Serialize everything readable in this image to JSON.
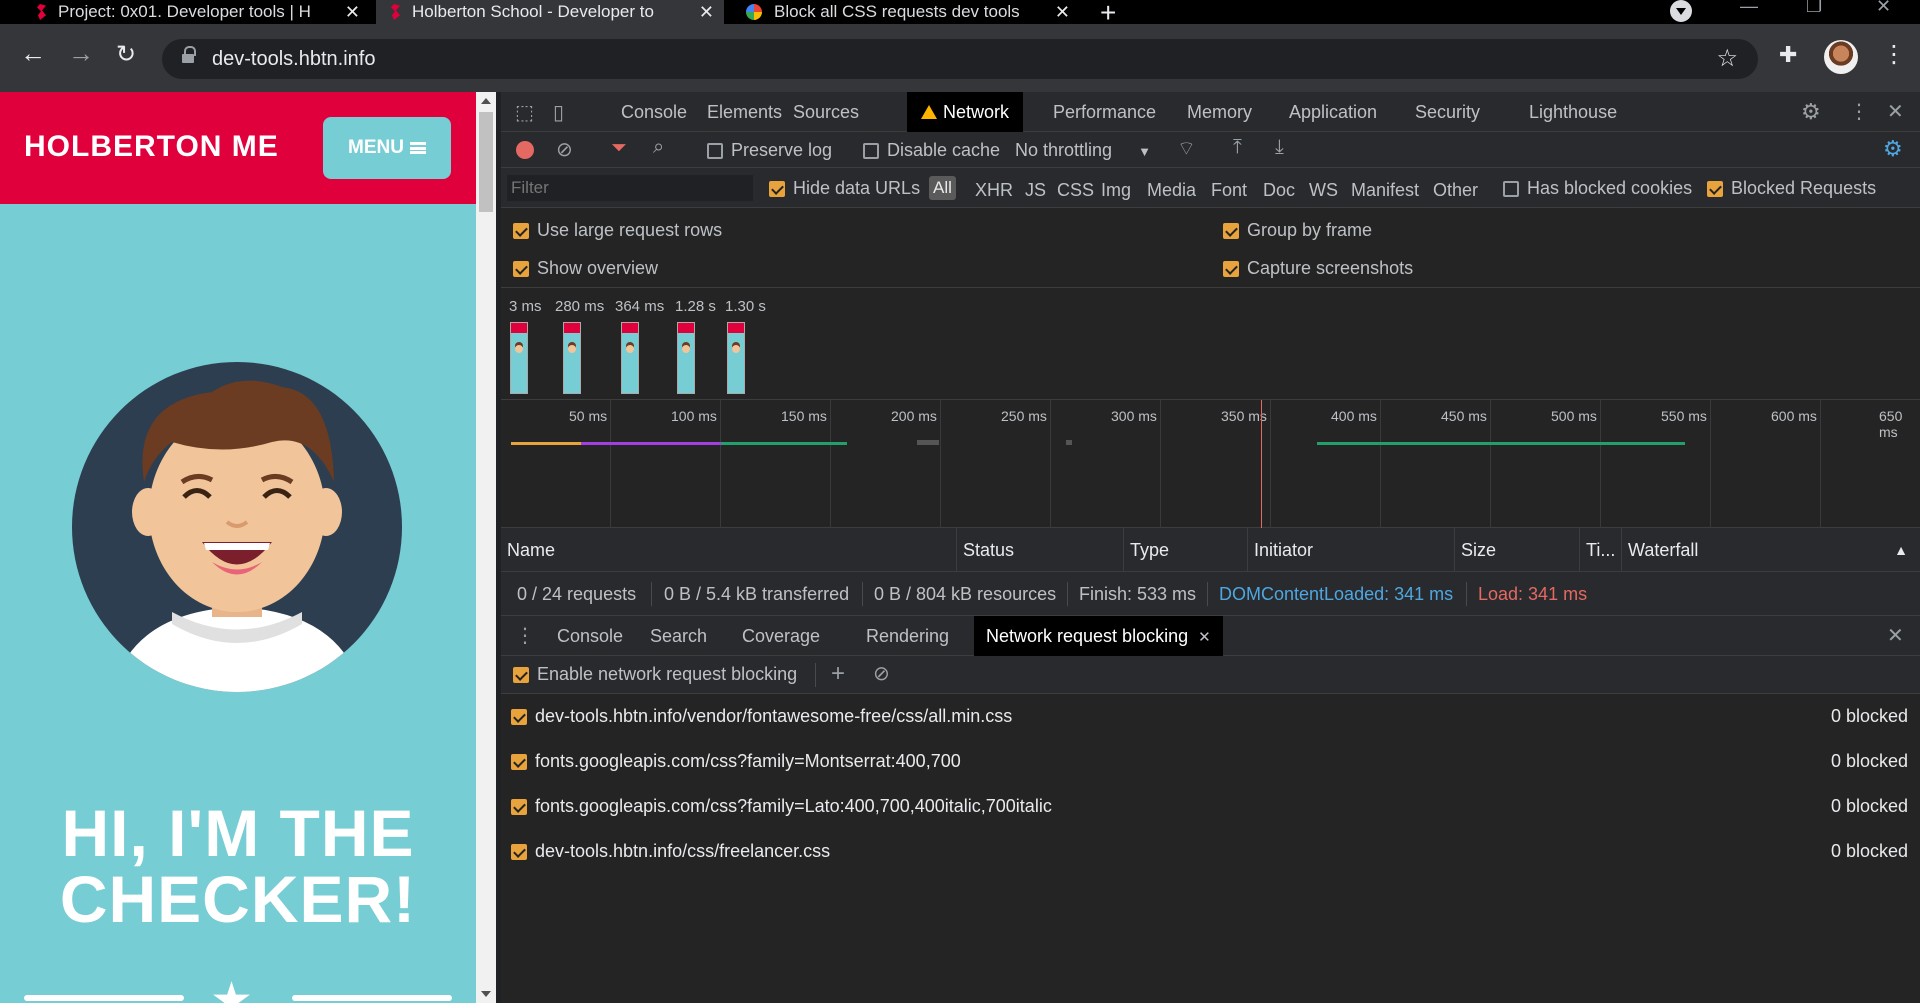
{
  "browser": {
    "tabs": [
      {
        "title": "Project: 0x01. Developer tools | H"
      },
      {
        "title": "Holberton School - Developer to"
      },
      {
        "title": "Block all CSS requests dev tools"
      }
    ],
    "url": "dev-tools.hbtn.info"
  },
  "page": {
    "brand": "HOLBERTON ME",
    "menu_label": "MENU",
    "hero_line1": "HI, I'M THE",
    "hero_line2": "CHECKER!"
  },
  "devtools": {
    "tabs": [
      "Console",
      "Elements",
      "Sources",
      "Network",
      "Performance",
      "Memory",
      "Application",
      "Security",
      "Lighthouse"
    ],
    "toolbar": {
      "preserve_log": "Preserve log",
      "disable_cache": "Disable cache",
      "throttling": "No throttling"
    },
    "filter": {
      "placeholder": "Filter",
      "hide_data_urls": "Hide data URLs",
      "all": "All",
      "types": [
        "XHR",
        "JS",
        "CSS",
        "Img",
        "Media",
        "Font",
        "Doc",
        "WS",
        "Manifest",
        "Other"
      ],
      "has_blocked_cookies": "Has blocked cookies",
      "blocked_requests": "Blocked Requests"
    },
    "settings": {
      "large_rows": "Use large request rows",
      "group_by_frame": "Group by frame",
      "show_overview": "Show overview",
      "capture_screenshots": "Capture screenshots"
    },
    "screenshot_times": [
      "3 ms",
      "280 ms",
      "364 ms",
      "1.28 s",
      "1.30 s"
    ],
    "timeline_ticks": [
      "50 ms",
      "100 ms",
      "150 ms",
      "200 ms",
      "250 ms",
      "300 ms",
      "350 ms",
      "400 ms",
      "450 ms",
      "500 ms",
      "550 ms",
      "600 ms",
      "650 ms"
    ],
    "columns": [
      "Name",
      "Status",
      "Type",
      "Initiator",
      "Size",
      "Ti...",
      "Waterfall"
    ],
    "summary": {
      "requests": "0 / 24 requests",
      "transferred": "0 B / 5.4 kB transferred",
      "resources": "0 B / 804 kB resources",
      "finish": "Finish: 533 ms",
      "dom": "DOMContentLoaded: 341 ms",
      "load": "Load: 341 ms"
    },
    "drawer_tabs": [
      "Console",
      "Search",
      "Coverage",
      "Rendering",
      "Network request blocking"
    ],
    "blocking": {
      "enable_label": "Enable network request blocking",
      "patterns": [
        {
          "url": "dev-tools.hbtn.info/vendor/fontawesome-free/css/all.min.css",
          "count": "0 blocked"
        },
        {
          "url": "fonts.googleapis.com/css?family=Montserrat:400,700",
          "count": "0 blocked"
        },
        {
          "url": "fonts.googleapis.com/css?family=Lato:400,700,400italic,700italic",
          "count": "0 blocked"
        },
        {
          "url": "dev-tools.hbtn.info/css/freelancer.css",
          "count": "0 blocked"
        }
      ]
    },
    "colors": {
      "accent": "#e8a33d",
      "dom_blue": "#4ea7e0",
      "load_red": "#e46962"
    }
  }
}
